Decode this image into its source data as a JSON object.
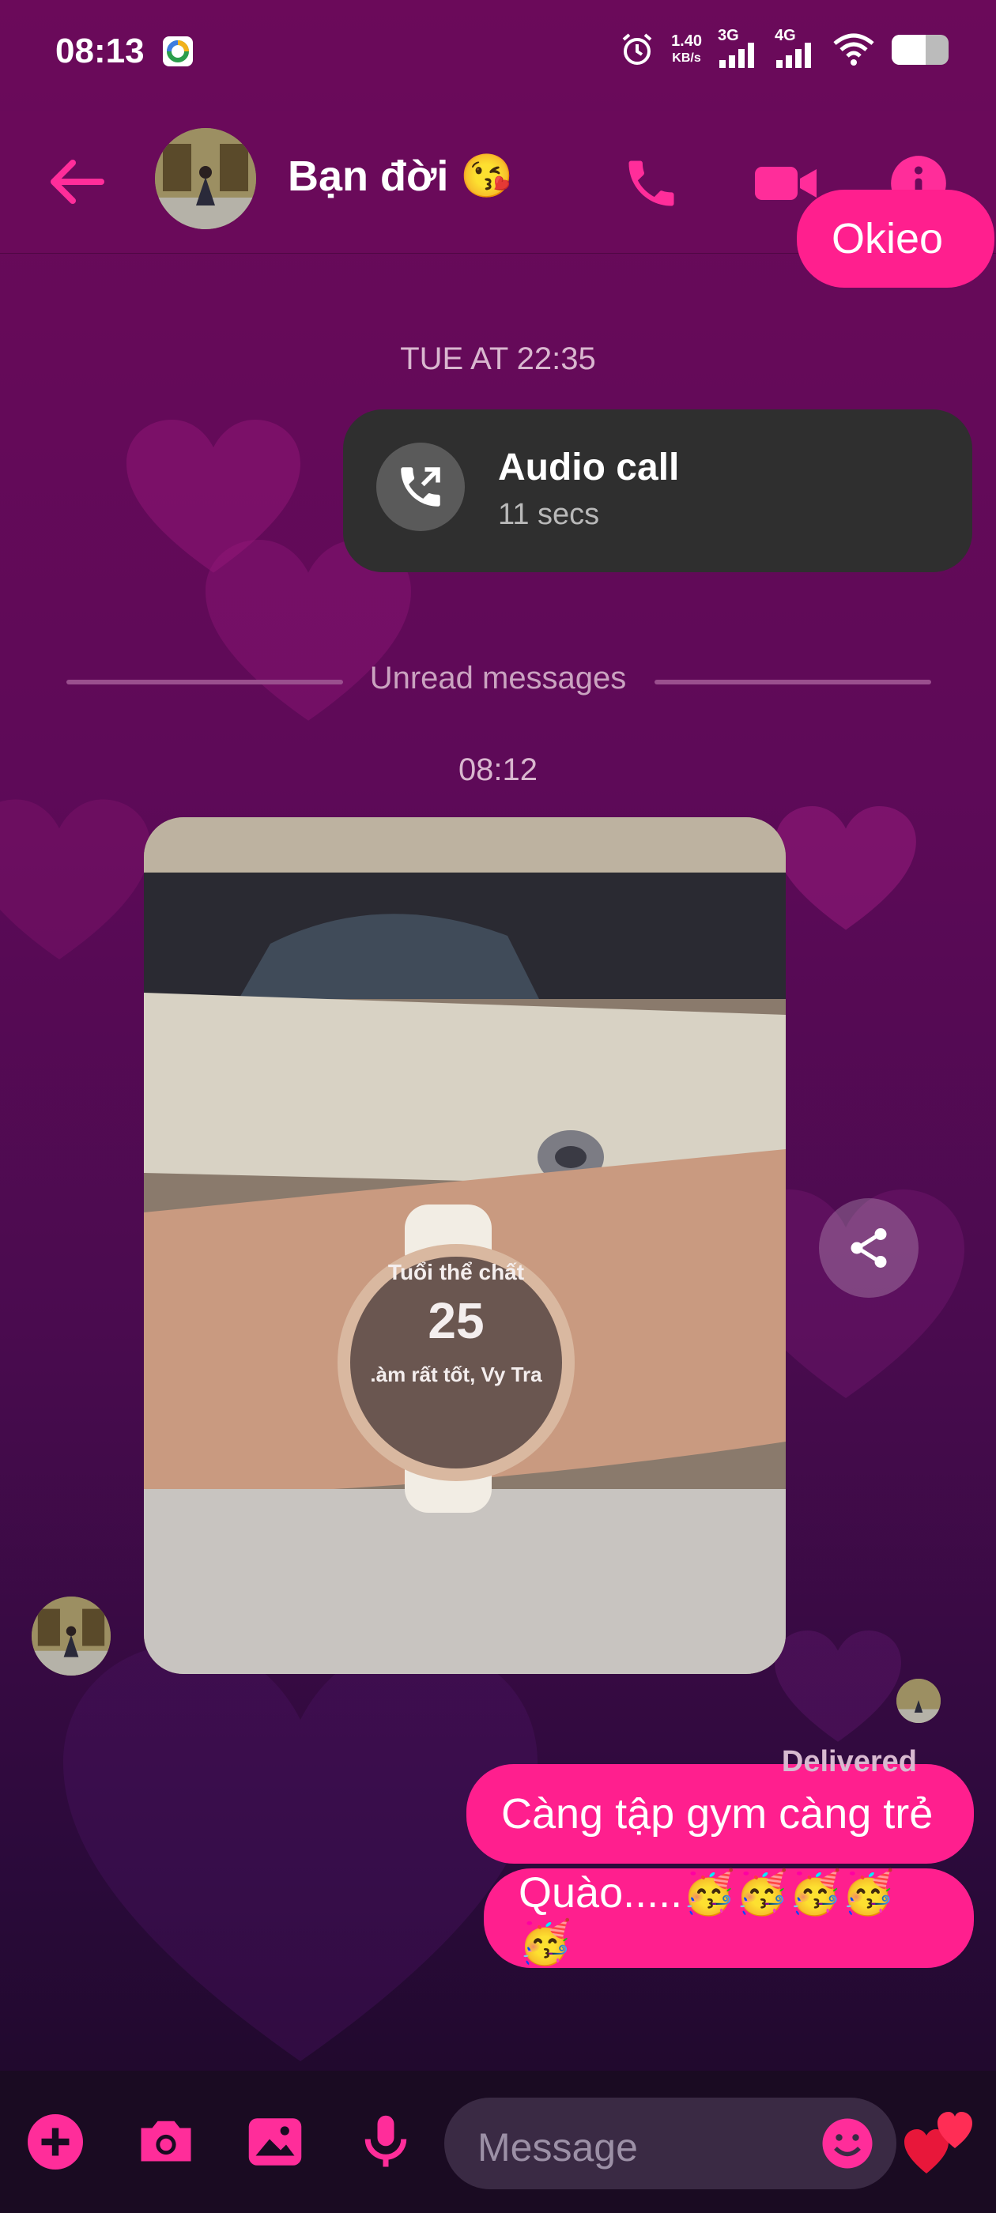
{
  "status_bar": {
    "time": "08:13",
    "net_speed_value": "1.40",
    "net_speed_unit": "KB/s",
    "sim1": "3G",
    "sim2": "4G",
    "battery_level": 0.6
  },
  "header": {
    "contact_name": "Bạn đời 😘"
  },
  "chat": {
    "partial_bubble_text": "Okieo",
    "call_timestamp": "TUE AT 22:35",
    "call": {
      "title": "Audio call",
      "duration": "11 secs"
    },
    "unread_label": "Unread messages",
    "photo_timestamp": "08:12",
    "photo": {
      "watch_title": "Tuổi thể chất",
      "watch_value": "25",
      "watch_sub": ".àm rất tốt, Vy Tra"
    },
    "outgoing": [
      "Càng tập gym càng trẻ",
      "Quào.....🥳🥳🥳🥳🥳"
    ],
    "delivered_label": "Delivered"
  },
  "composer": {
    "placeholder": "Message"
  },
  "colors": {
    "accent": "#ff1f8e",
    "header_bg": "#6a0a5a"
  }
}
